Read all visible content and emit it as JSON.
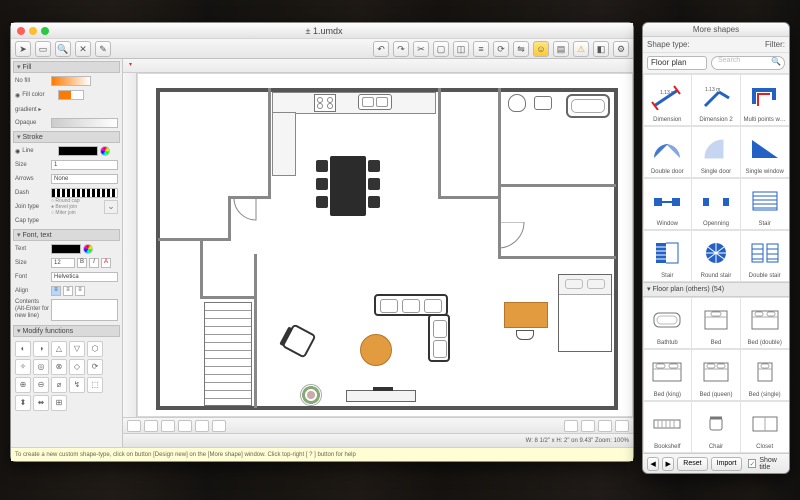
{
  "window": {
    "title": "± 1.umdx"
  },
  "toolbar_icons": [
    "cursor-icon",
    "redo-icon",
    "zoom-icon",
    "eraser-icon",
    "dropper-icon",
    "text-icon"
  ],
  "toolbar_icons_right": [
    "undo-icon",
    "redo-icon",
    "cut-icon",
    "rect-icon",
    "group-icon",
    "align-icon",
    "rotate-icon",
    "flip-icon",
    "smiley-icon",
    "note-icon",
    "warning-icon",
    "rect2-icon",
    "gear-icon"
  ],
  "panels": {
    "fill": {
      "title": "Fill",
      "nofill_label": "No fill",
      "fillcolor_label": "Fill color",
      "gradient_label": "gradient ▸",
      "opaque_label": "Opaque"
    },
    "stroke": {
      "title": "Stroke",
      "line_label": "Line",
      "size_label": "Size",
      "arrows_label": "Arrows",
      "arrows_value": "None",
      "dash_label": "Dash",
      "join_label": "Join type",
      "join_opts": [
        "Round cap",
        "Bevel join",
        "Miter join"
      ],
      "cap_label": "Cap type"
    },
    "font": {
      "title": "Font, text",
      "text_label": "Text",
      "size_label": "Size",
      "size_value": "12",
      "font_label": "Font",
      "font_value": "Helvetica",
      "align_label": "Align",
      "contents_label": "Contents (Alt-Enter for new line)"
    },
    "modify": {
      "title": "Modify functions"
    }
  },
  "status": {
    "hint": "To create a new custom shape-type, click on button [Design new] on the [More shape] window. Click top-right [ ? ] button for help",
    "coords": "W: 8 1/2\" x H: 2\" on 9.43\"  Zoom: 100%"
  },
  "palette": {
    "title": "More shapes",
    "shape_type_label": "Shape type:",
    "shape_type_value": "Floor plan",
    "filter_label": "Filter:",
    "search_placeholder": "Search",
    "section1_shapes": [
      {
        "name": "Dimension",
        "glyph": "dim"
      },
      {
        "name": "Dimension 2",
        "glyph": "dim2"
      },
      {
        "name": "Multi points w…",
        "glyph": "multiw"
      },
      {
        "name": "Double door",
        "glyph": "ddoor"
      },
      {
        "name": "Single door",
        "glyph": "sdoor"
      },
      {
        "name": "Single window",
        "glyph": "swin"
      },
      {
        "name": "Window",
        "glyph": "window"
      },
      {
        "name": "Openning",
        "glyph": "opening"
      },
      {
        "name": "Stair",
        "glyph": "stair"
      },
      {
        "name": "Stair",
        "glyph": "stair2"
      },
      {
        "name": "Round stair",
        "glyph": "rstair"
      },
      {
        "name": "Double stair",
        "glyph": "dstair"
      }
    ],
    "section2_title": "▾ Floor plan (others) (54)",
    "section2_shapes": [
      {
        "name": "Bathtub",
        "glyph": "bath"
      },
      {
        "name": "Bed",
        "glyph": "bed"
      },
      {
        "name": "Bed (double)",
        "glyph": "bed2"
      },
      {
        "name": "Bed (king)",
        "glyph": "bedk"
      },
      {
        "name": "Bed (queen)",
        "glyph": "bedq"
      },
      {
        "name": "Bed (single)",
        "glyph": "beds"
      },
      {
        "name": "Bookshelf",
        "glyph": "shelf"
      },
      {
        "name": "Chair",
        "glyph": "chair"
      },
      {
        "name": "Closet",
        "glyph": "closet"
      }
    ],
    "footer": {
      "prev": "◀",
      "next": "▶",
      "reset": "Reset",
      "import": "Import",
      "showtitle": "Show title"
    }
  }
}
